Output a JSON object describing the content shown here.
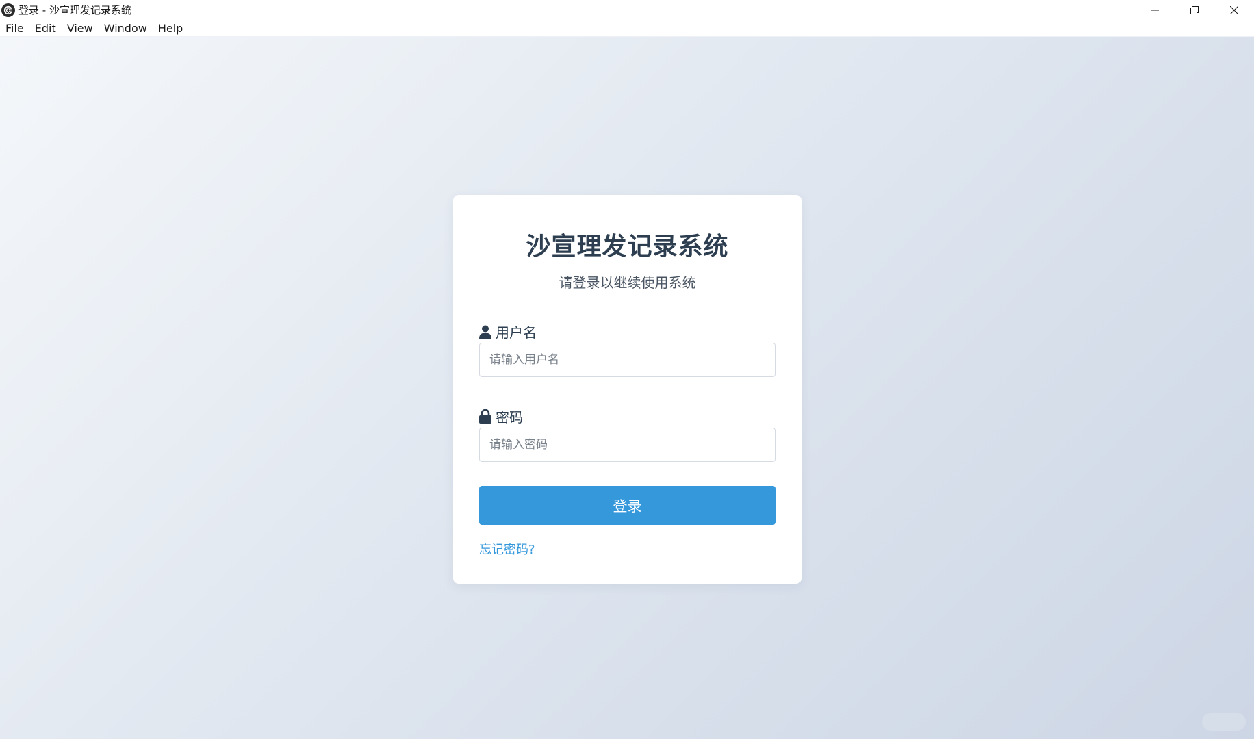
{
  "window": {
    "title": "登录 - 沙宣理发记录系统",
    "controls": [
      "minimize",
      "restore",
      "close"
    ]
  },
  "menubar": {
    "items": [
      "File",
      "Edit",
      "View",
      "Window",
      "Help"
    ]
  },
  "login": {
    "title": "沙宣理发记录系统",
    "subtitle": "请登录以继续使用系统",
    "username": {
      "label": "用户名",
      "icon": "user-icon",
      "placeholder": "请输入用户名",
      "value": ""
    },
    "password": {
      "label": "密码",
      "icon": "lock-icon",
      "placeholder": "请输入密码",
      "value": ""
    },
    "submit_label": "登录",
    "forgot_label": "忘记密码?"
  },
  "colors": {
    "accent": "#3498db",
    "title_text": "#2c3e50",
    "background_start": "#f4f7fa",
    "background_end": "#cdd6e5"
  }
}
